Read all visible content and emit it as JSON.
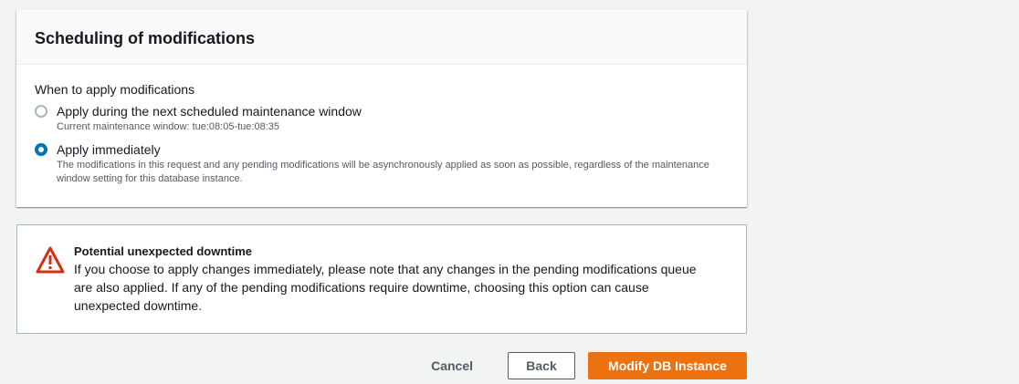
{
  "panel": {
    "title": "Scheduling of modifications",
    "field_label": "When to apply modifications",
    "options": [
      {
        "label": "Apply during the next scheduled maintenance window",
        "description": "Current maintenance window: tue:08:05-tue:08:35",
        "checked": false
      },
      {
        "label": "Apply immediately",
        "description": "The modifications in this request and any pending modifications will be asynchronously applied as soon as possible, regardless of the maintenance window setting for this database instance.",
        "checked": true
      }
    ]
  },
  "alert": {
    "icon": "warning-icon",
    "title": "Potential unexpected downtime",
    "text": "If you choose to apply changes immediately, please note that any changes in the pending modifications queue are also applied. If any of the pending modifications require downtime, choosing this option can cause unexpected downtime."
  },
  "actions": {
    "cancel_label": "Cancel",
    "back_label": "Back",
    "submit_label": "Modify DB Instance"
  },
  "colors": {
    "primary": "#ec7211",
    "radio_selected": "#0073bb",
    "warning": "#d13212",
    "background": "#f2f3f3"
  }
}
